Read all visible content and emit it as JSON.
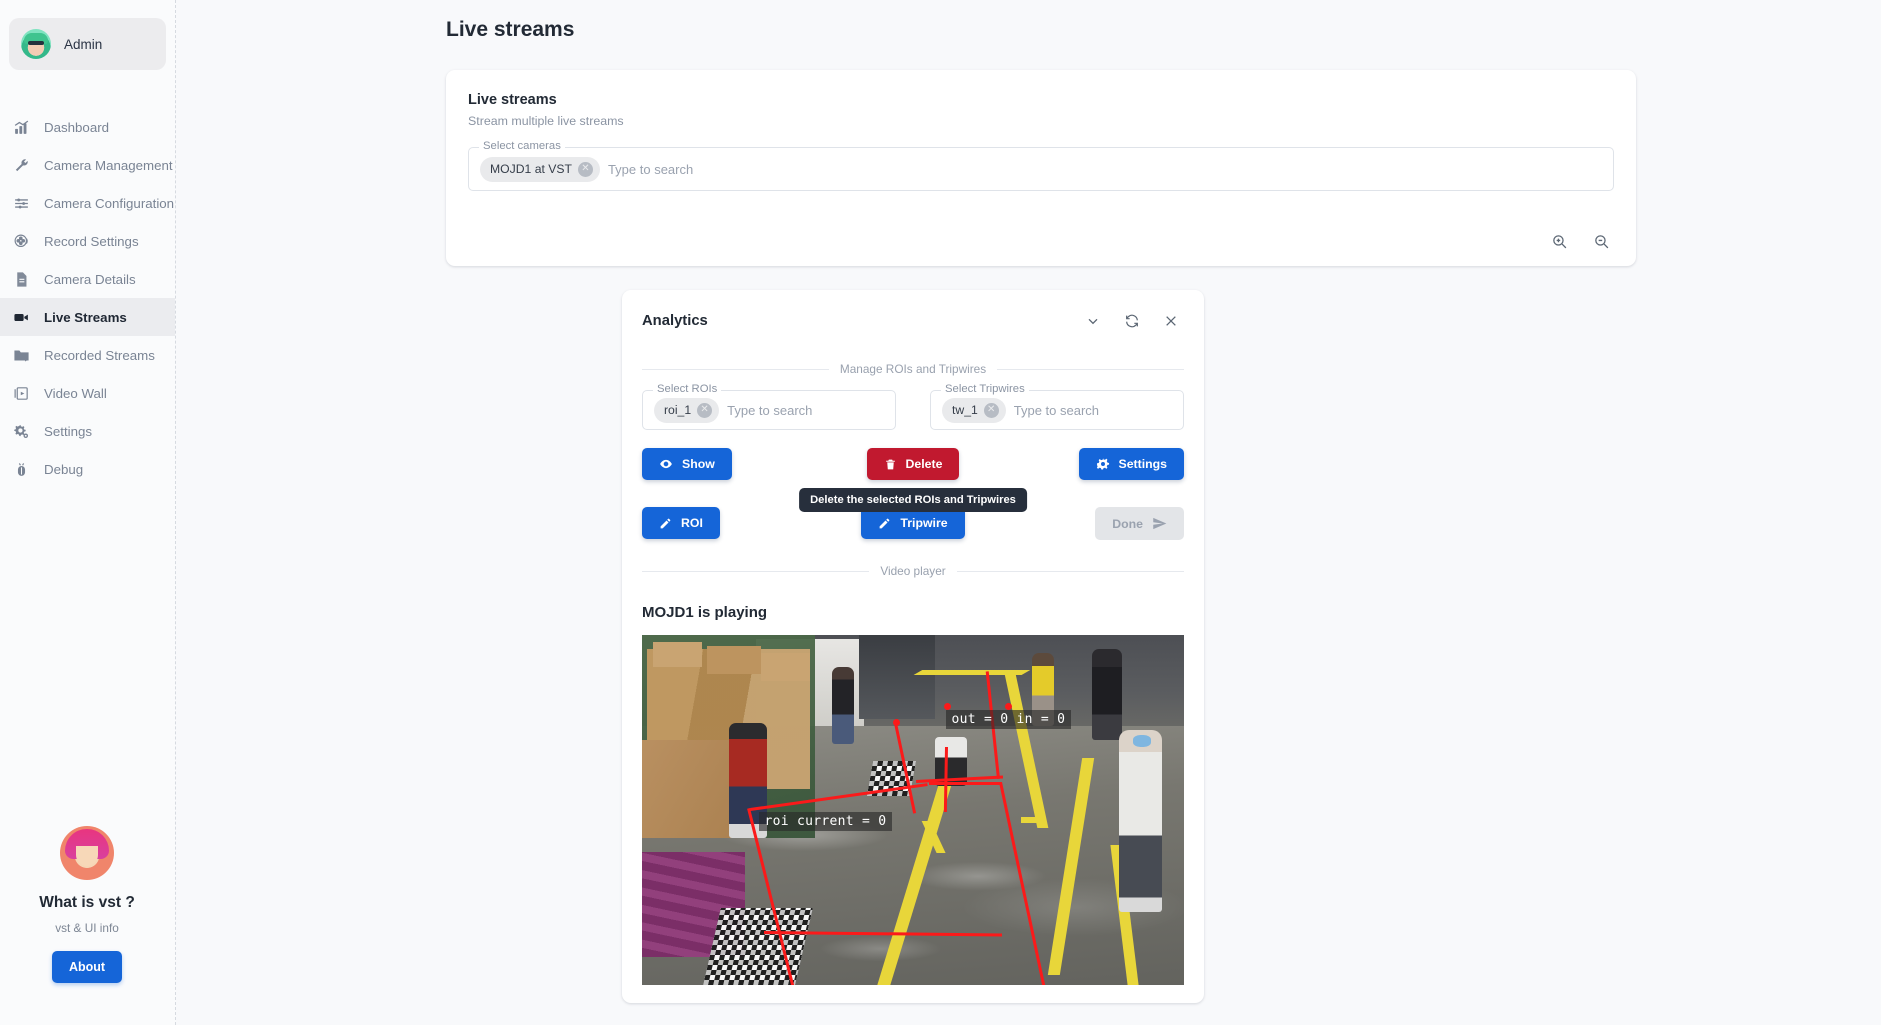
{
  "sidebar": {
    "user": {
      "name": "Admin",
      "avatar_icon": "admin-avatar"
    },
    "items": [
      {
        "label": "Dashboard",
        "icon": "chart-bars-icon",
        "active": false
      },
      {
        "label": "Camera Management",
        "icon": "wrench-icon",
        "active": false
      },
      {
        "label": "Camera Configuration",
        "icon": "sliders-icon",
        "active": false
      },
      {
        "label": "Record Settings",
        "icon": "film-reel-icon",
        "active": false
      },
      {
        "label": "Camera Details",
        "icon": "document-icon",
        "active": false
      },
      {
        "label": "Live Streams",
        "icon": "video-camera-icon",
        "active": true
      },
      {
        "label": "Recorded Streams",
        "icon": "folder-play-icon",
        "active": false
      },
      {
        "label": "Video Wall",
        "icon": "video-wall-icon",
        "active": false
      },
      {
        "label": "Settings",
        "icon": "gear-icon",
        "active": false
      },
      {
        "label": "Debug",
        "icon": "bug-icon",
        "active": false
      }
    ],
    "promo": {
      "avatar_icon": "vst-mascot-avatar",
      "title": "What is vst ?",
      "subtitle": "vst & UI info",
      "button_label": "About"
    }
  },
  "page": {
    "title": "Live streams"
  },
  "live_streams_card": {
    "title": "Live streams",
    "subtitle": "Stream multiple live streams",
    "camera_select": {
      "legend": "Select cameras",
      "chips": [
        "MOJD1 at VST"
      ],
      "placeholder": "Type to search",
      "value": ""
    },
    "zoom_in_icon": "zoom-in-icon",
    "zoom_out_icon": "zoom-out-icon"
  },
  "analytics_card": {
    "title": "Analytics",
    "header_icons": [
      "chevron-down-icon",
      "refresh-icon",
      "close-icon"
    ],
    "manage_divider": "Manage ROIs and Tripwires",
    "roi_select": {
      "legend": "Select ROIs",
      "chips": [
        "roi_1"
      ],
      "placeholder": "Type to search",
      "value": ""
    },
    "tripwire_select": {
      "legend": "Select Tripwires",
      "chips": [
        "tw_1"
      ],
      "placeholder": "Type to search",
      "value": ""
    },
    "buttons_row1": [
      {
        "label": "Show",
        "icon": "eye-icon",
        "style": "blue",
        "disabled": false
      },
      {
        "label": "Delete",
        "icon": "trash-icon",
        "style": "red",
        "disabled": false
      },
      {
        "label": "Settings",
        "icon": "gear-icon",
        "style": "blue",
        "disabled": false
      }
    ],
    "tooltip": "Delete the selected ROIs and Tripwires",
    "buttons_row2": [
      {
        "label": "ROI",
        "icon": "pencil-icon",
        "style": "blue",
        "disabled": false
      },
      {
        "label": "Tripwire",
        "icon": "pencil-icon",
        "style": "blue",
        "disabled": false
      },
      {
        "label": "Done",
        "icon": "send-icon",
        "style": "disabled",
        "disabled": true
      }
    ],
    "video_divider": "Video player",
    "video_title": "MOJD1 is playing",
    "video_overlays": {
      "tripwire_counter": "out = 0 in = 0",
      "roi_counter": "roi current = 0"
    }
  },
  "colors": {
    "primary_blue": "#1565d8",
    "danger_red": "#c1192f",
    "roi_red": "#fb1a1a",
    "tape_yellow": "#e8d63a",
    "page_bg": "#f8f9fb",
    "sidebar_bg": "#fafbfc",
    "active_nav_bg": "#ebecef"
  }
}
